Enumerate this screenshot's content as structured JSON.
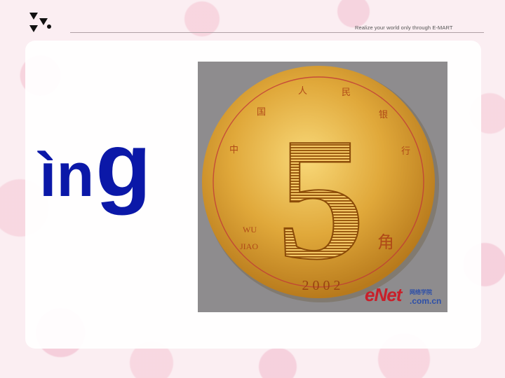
{
  "header": {
    "tagline": "Realize your world only through E-MART"
  },
  "slide": {
    "syllable_main": "ìn",
    "syllable_tail": "g"
  },
  "coin": {
    "top_text": [
      "中",
      "国",
      "人",
      "民",
      "银",
      "行"
    ],
    "denomination": "5",
    "pinyin_line1": "WU",
    "pinyin_line2": "JIAO",
    "unit_char": "角",
    "year": "2 0 0 2"
  },
  "watermark": {
    "brand": "eNet",
    "site_cn": "网络学院",
    "domain": ".com.cn"
  }
}
